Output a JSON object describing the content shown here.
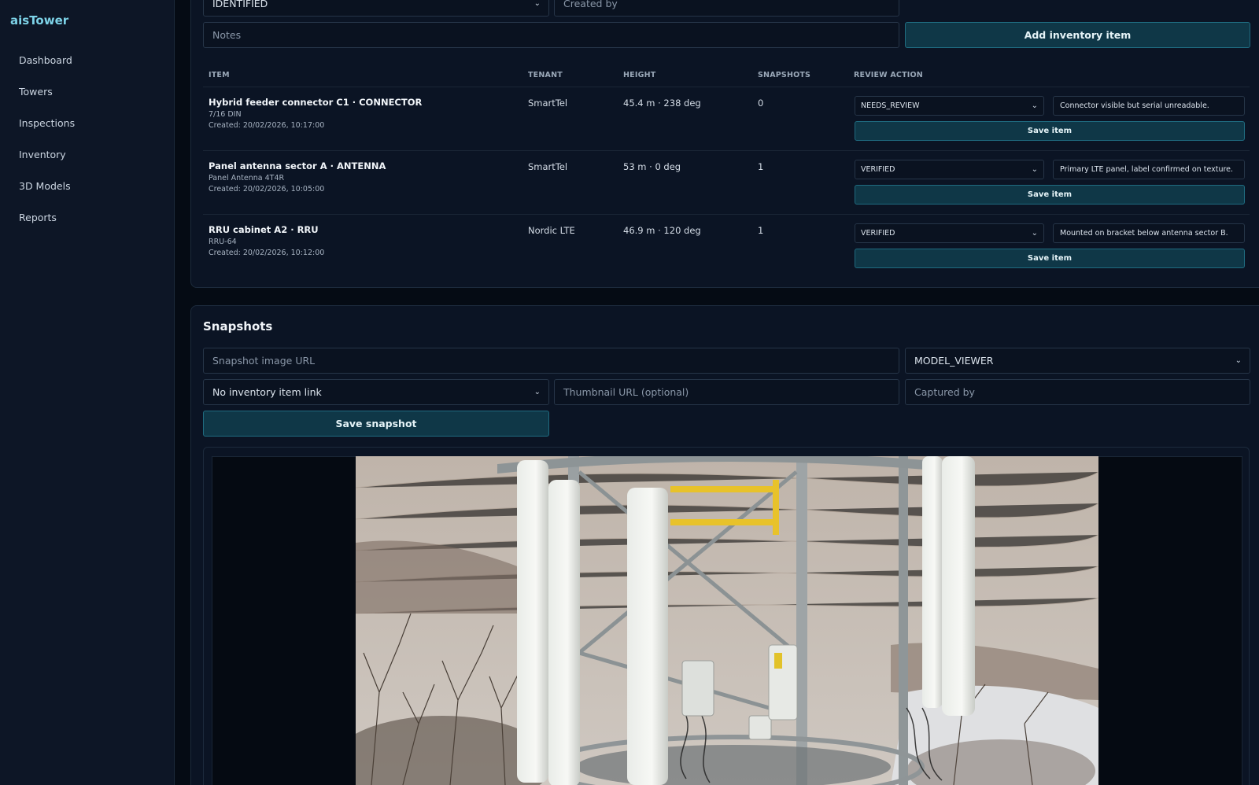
{
  "app": {
    "brand": "aisTower"
  },
  "sidebar": {
    "items": [
      {
        "label": "Dashboard"
      },
      {
        "label": "Towers"
      },
      {
        "label": "Inspections"
      },
      {
        "label": "Inventory"
      },
      {
        "label": "3D Models"
      },
      {
        "label": "Reports"
      }
    ]
  },
  "inventory_form": {
    "status_value": "IDENTIFIED",
    "created_by_placeholder": "Created by",
    "notes_placeholder": "Notes",
    "add_button": "Add inventory item"
  },
  "inventory_table": {
    "headers": [
      "ITEM",
      "TENANT",
      "HEIGHT",
      "SNAPSHOTS",
      "REVIEW ACTION"
    ],
    "rows": [
      {
        "title": "Hybrid feeder connector C1 · CONNECTOR",
        "model": "7/16 DIN",
        "created": "Created: 20/02/2026, 10:17:00",
        "tenant": "SmartTel",
        "height": "45.4 m · 238 deg",
        "snapshots": "0",
        "review_status": "NEEDS_REVIEW",
        "review_note": "Connector visible but serial unreadable.",
        "save_label": "Save item"
      },
      {
        "title": "Panel antenna sector A · ANTENNA",
        "model": "Panel Antenna 4T4R",
        "created": "Created: 20/02/2026, 10:05:00",
        "tenant": "SmartTel",
        "height": "53 m · 0 deg",
        "snapshots": "1",
        "review_status": "VERIFIED",
        "review_note": "Primary LTE panel, label confirmed on texture.",
        "save_label": "Save item"
      },
      {
        "title": "RRU cabinet A2 · RRU",
        "model": "RRU-64",
        "created": "Created: 20/02/2026, 10:12:00",
        "tenant": "Nordic LTE",
        "height": "46.9 m · 120 deg",
        "snapshots": "1",
        "review_status": "VERIFIED",
        "review_note": "Mounted on bracket below antenna sector B.",
        "save_label": "Save item"
      }
    ]
  },
  "snapshots": {
    "title": "Snapshots",
    "image_url_placeholder": "Snapshot image URL",
    "source_value": "MODEL_VIEWER",
    "inventory_link_value": "No inventory item link",
    "thumbnail_placeholder": "Thumbnail URL (optional)",
    "captured_by_placeholder": "Captured by",
    "save_button": "Save snapshot"
  },
  "icons": {
    "select": "chevron-down-icon"
  }
}
